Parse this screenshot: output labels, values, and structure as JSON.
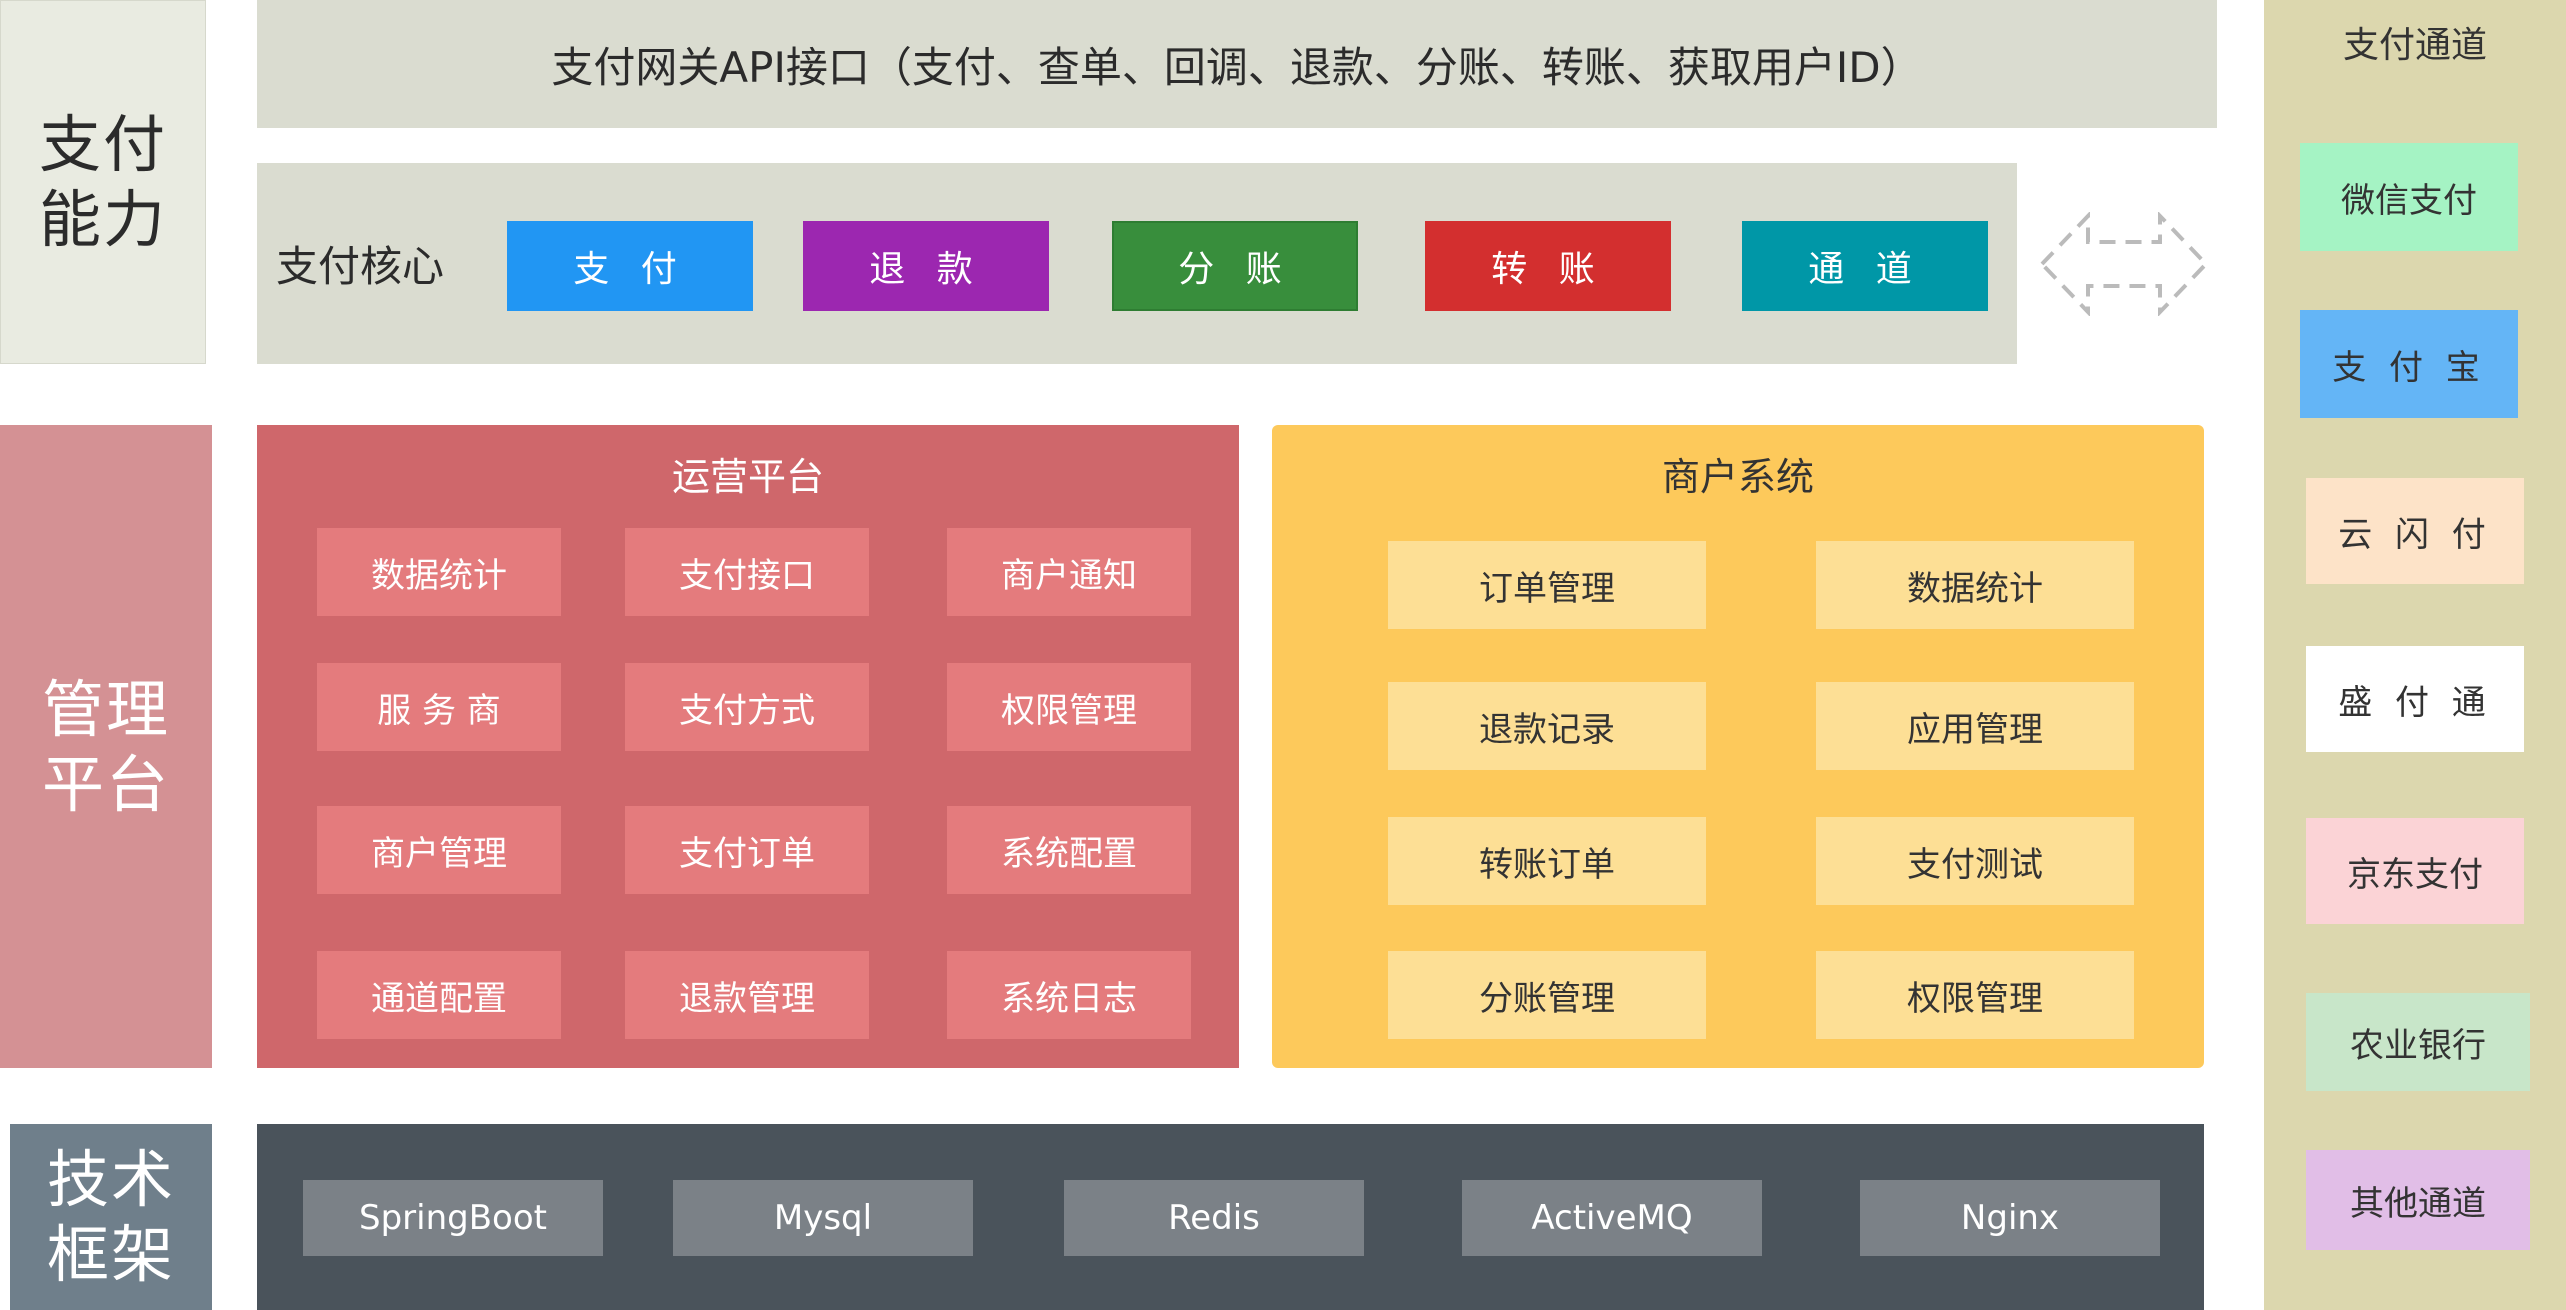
{
  "colors": {
    "pay_ability_bg": "#e9ebe1",
    "gateway_bg": "#dadcd0",
    "core_bg": "#dadcd0",
    "mgmt_label_bg": "#d49194",
    "ops_bg": "#cf676b",
    "ops_item_bg": "#e47b7d",
    "merchant_bg": "#fdc95b",
    "merchant_item_bg": "#fddf95",
    "tech_label_bg": "#6f7f8b",
    "tech_bg": "#4a535b",
    "tech_item_bg": "#7b8187",
    "channel_bg": "#dcd7ae"
  },
  "pay_ability": {
    "label": "支付\n能力",
    "gateway": "支付网关API接口（支付、查单、回调、退款、分账、转账、获取用户ID）",
    "core_label": "支付核心",
    "core_buttons": [
      {
        "label": "支 付",
        "color": "#2196f3"
      },
      {
        "label": "退 款",
        "color": "#9c27b0"
      },
      {
        "label": "分 账",
        "color": "#388e3c"
      },
      {
        "label": "转 账",
        "color": "#d32f2f"
      },
      {
        "label": "通 道",
        "color": "#0097a7"
      }
    ],
    "arrow_icon": "double-arrow-icon"
  },
  "management": {
    "label": "管理\n平台",
    "ops": {
      "title": "运营平台",
      "items": [
        "数据统计",
        "支付接口",
        "商户通知",
        "服 务 商",
        "支付方式",
        "权限管理",
        "商户管理",
        "支付订单",
        "系统配置",
        "通道配置",
        "退款管理",
        "系统日志"
      ]
    },
    "merchant": {
      "title": "商户系统",
      "items": [
        "订单管理",
        "数据统计",
        "退款记录",
        "应用管理",
        "转账订单",
        "支付测试",
        "分账管理",
        "权限管理"
      ]
    }
  },
  "tech": {
    "label": "技术\n框架",
    "items": [
      "SpringBoot",
      "Mysql",
      "Redis",
      "ActiveMQ",
      "Nginx"
    ]
  },
  "channels": {
    "title": "支付通道",
    "items": [
      {
        "label": "微信支付",
        "color": "#a5f3c4"
      },
      {
        "label": "支 付 宝",
        "color": "#64b5f6"
      },
      {
        "label": "云 闪 付",
        "color": "#fde3c8"
      },
      {
        "label": "盛 付 通",
        "color": "#ffffff"
      },
      {
        "label": "京东支付",
        "color": "#fbd3d6"
      },
      {
        "label": "农业银行",
        "color": "#c8e6c9"
      },
      {
        "label": "其他通道",
        "color": "#e1bee7"
      }
    ]
  }
}
